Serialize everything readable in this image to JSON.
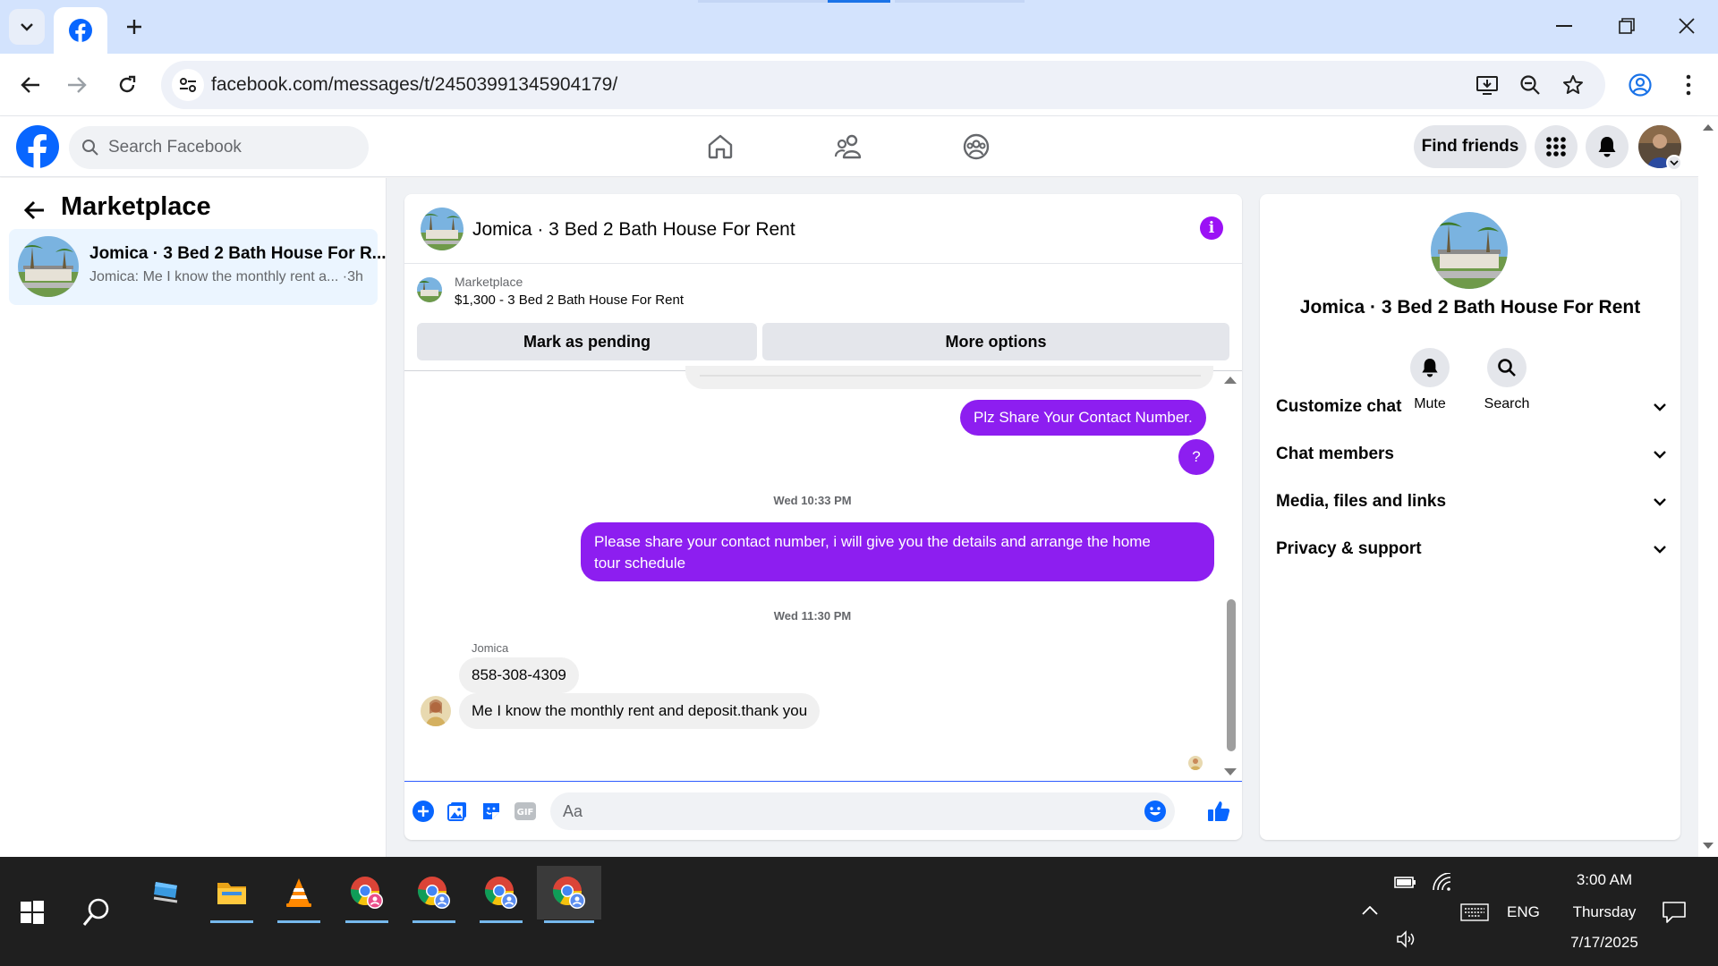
{
  "browser": {
    "url": "facebook.com/messages/t/24503991345904179/",
    "tab_favicon": "facebook-icon",
    "accent": "#d3e3fd"
  },
  "fb": {
    "search_placeholder": "Search Facebook",
    "find_friends": "Find friends",
    "brand_color": "#0866ff"
  },
  "left_panel": {
    "title": "Marketplace",
    "conversation": {
      "name": "Jomica · 3 Bed 2 Bath House For R...",
      "preview": "Jomica: Me I know the monthly rent a... ·3h"
    }
  },
  "chat": {
    "title": "Jomica · 3 Bed 2 Bath House For Rent",
    "marketplace_label": "Marketplace",
    "listing": "$1,300 - 3 Bed 2 Bath House For Rent",
    "mark_pending": "Mark as pending",
    "more_options": "More options",
    "messages": {
      "out1": "Plz Share Your Contact Number.",
      "out2": "?",
      "ts1": "Wed 10:33 PM",
      "out3_line1": "Please share your contact number, i will give you the details and arrange the home",
      "out3_line2": "tour schedule",
      "ts2": "Wed 11:30 PM",
      "sender": "Jomica",
      "in1": "858-308-4309",
      "in2": "Me I know the monthly rent and deposit.thank you"
    },
    "composer_placeholder": "Aa",
    "out_bubble_color": "#8d1ef0"
  },
  "right_panel": {
    "title": "Jomica · 3 Bed 2 Bath House For Rent",
    "mute": "Mute",
    "search": "Search",
    "sections": [
      "Customize chat",
      "Chat members",
      "Media, files and links",
      "Privacy & support"
    ]
  },
  "taskbar": {
    "lang": "ENG",
    "time": "3:00 AM",
    "day": "Thursday",
    "date": "7/17/2025"
  }
}
